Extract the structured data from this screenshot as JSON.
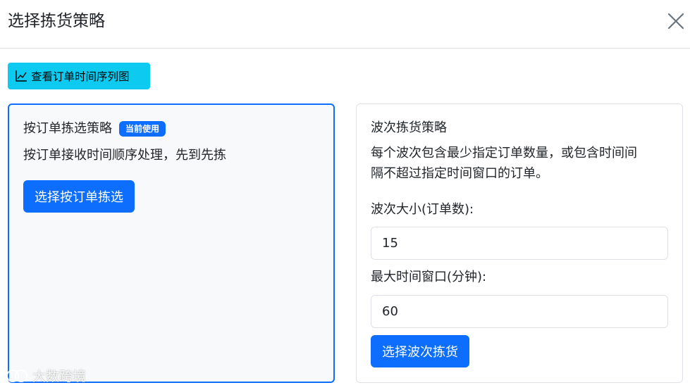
{
  "modal": {
    "title": "选择拣货策略",
    "close_icon": "close-icon"
  },
  "toolbar": {
    "timeline_button_label": "查看订单时间序列图",
    "timeline_icon": "line-chart-icon",
    "button_color": "#0dcaf0"
  },
  "order_strategy": {
    "title": "按订单拣选策略",
    "badge": "当前使用",
    "description": "按订单接收时间顺序处理，先到先拣",
    "button_label": "选择按订单拣选",
    "active_border_color": "#0d6efd"
  },
  "wave_strategy": {
    "title": "波次拣货策略",
    "description_line1": "每个波次包含最少指定订单数量，或包含时间间",
    "description_line2": "隔不超过指定时间窗口的订单。",
    "wave_size_label": "波次大小(订单数):",
    "wave_size_value": "15",
    "time_window_label": "最大时间窗口(分钟):",
    "time_window_value": "60",
    "button_label": "选择波次拣货"
  },
  "watermark": {
    "text": "大数跨境"
  },
  "colors": {
    "primary": "#0d6efd",
    "info": "#0dcaf0",
    "light_bg": "#f8f9fa",
    "border": "#dee2e6"
  }
}
